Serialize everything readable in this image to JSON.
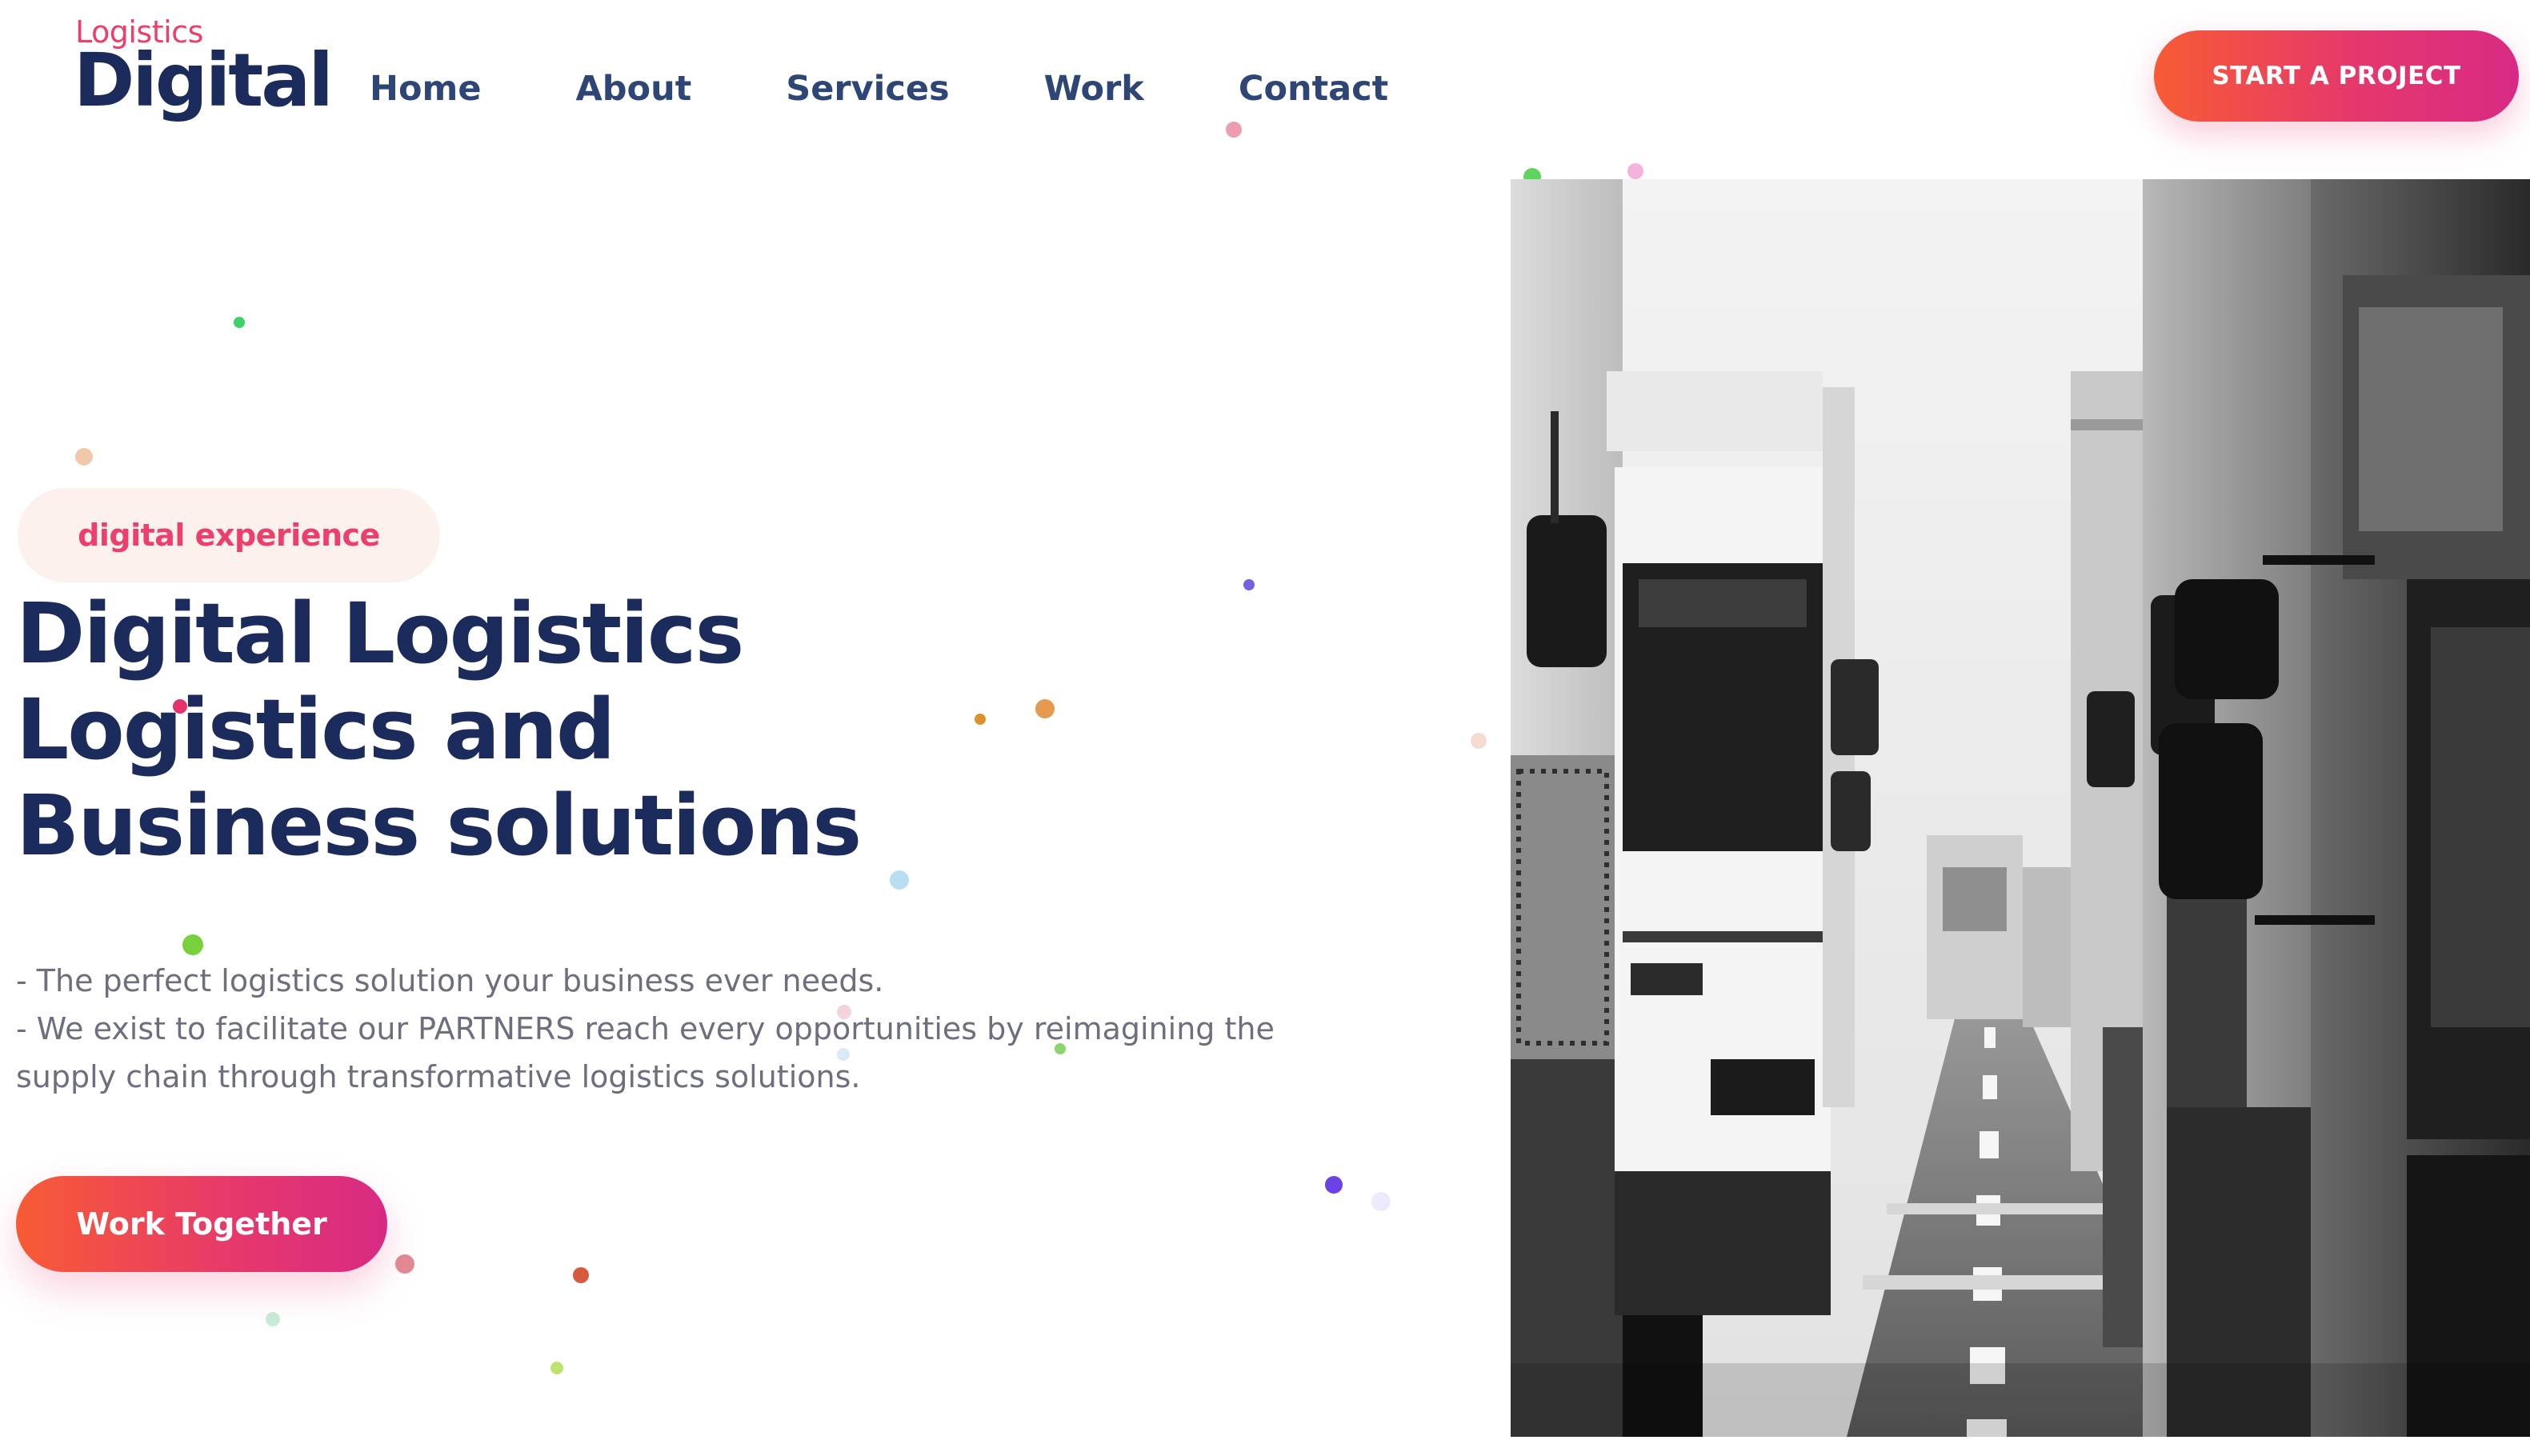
{
  "logo": {
    "sub": "Logistics",
    "main": "Digital"
  },
  "nav": {
    "items": [
      {
        "label": "Home"
      },
      {
        "label": "About"
      },
      {
        "label": "Services"
      },
      {
        "label": "Work"
      },
      {
        "label": "Contact"
      }
    ]
  },
  "header": {
    "cta_label": "START A PROJECT"
  },
  "hero": {
    "badge": "digital experience",
    "headline": [
      "Digital Logistics",
      "Logistics and",
      "Business solutions"
    ],
    "description": [
      "- The perfect logistics solution your business ever needs.",
      "- We exist to facilitate our PARTNERS reach every opportunities by reimagining the supply chain through transformative logistics solutions."
    ],
    "cta_label": "Work Together",
    "image_subject": "black-and-white photo of trucks lined up on a highway"
  },
  "colors": {
    "brand_navy": "#1b2b5c",
    "nav_text": "#2e4675",
    "accent_pink": "#ec3f6b",
    "gradient_start": "#f85b35",
    "gradient_end": "#d82a84",
    "body_text": "#6d6f7e",
    "badge_bg": "#fdf1ee"
  }
}
